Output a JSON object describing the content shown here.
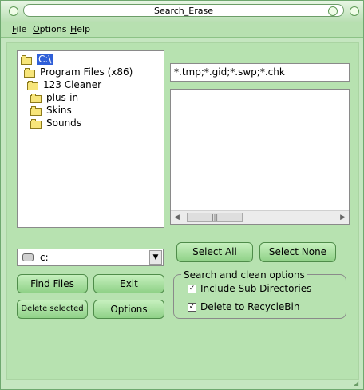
{
  "window": {
    "title": "Search_Erase"
  },
  "menu": {
    "file": {
      "accel": "F",
      "rest": "ile"
    },
    "options": {
      "accel": "O",
      "rest": "ptions"
    },
    "help": {
      "accel": "H",
      "rest": "elp"
    }
  },
  "tree": {
    "items": [
      {
        "label": "C:\\",
        "selected": true
      },
      {
        "label": "Program Files (x86)"
      },
      {
        "label": "123 Cleaner"
      },
      {
        "label": "plus-in"
      },
      {
        "label": "Skins"
      },
      {
        "label": "Sounds"
      }
    ]
  },
  "mask": {
    "value": "*.tmp;*.gid;*.swp;*.chk"
  },
  "drive": {
    "value": "c:"
  },
  "buttons": {
    "select_all": "Select All",
    "select_none": "Select None",
    "find_files": "Find Files",
    "exit": "Exit",
    "delete_selected": "Delete selected",
    "options": "Options"
  },
  "options_group": {
    "title": "Search and clean options",
    "include_sub": "Include Sub Directories",
    "delete_recycle": "Delete to RecycleBin"
  },
  "icons": [
    "folder-icon",
    "drive-icon",
    "checkbox-icon",
    "dropdown-arrow-icon"
  ],
  "colors": {
    "window_bg": "#c5e6c0",
    "button": "#9ad592",
    "selection": "#2f5fd8"
  }
}
